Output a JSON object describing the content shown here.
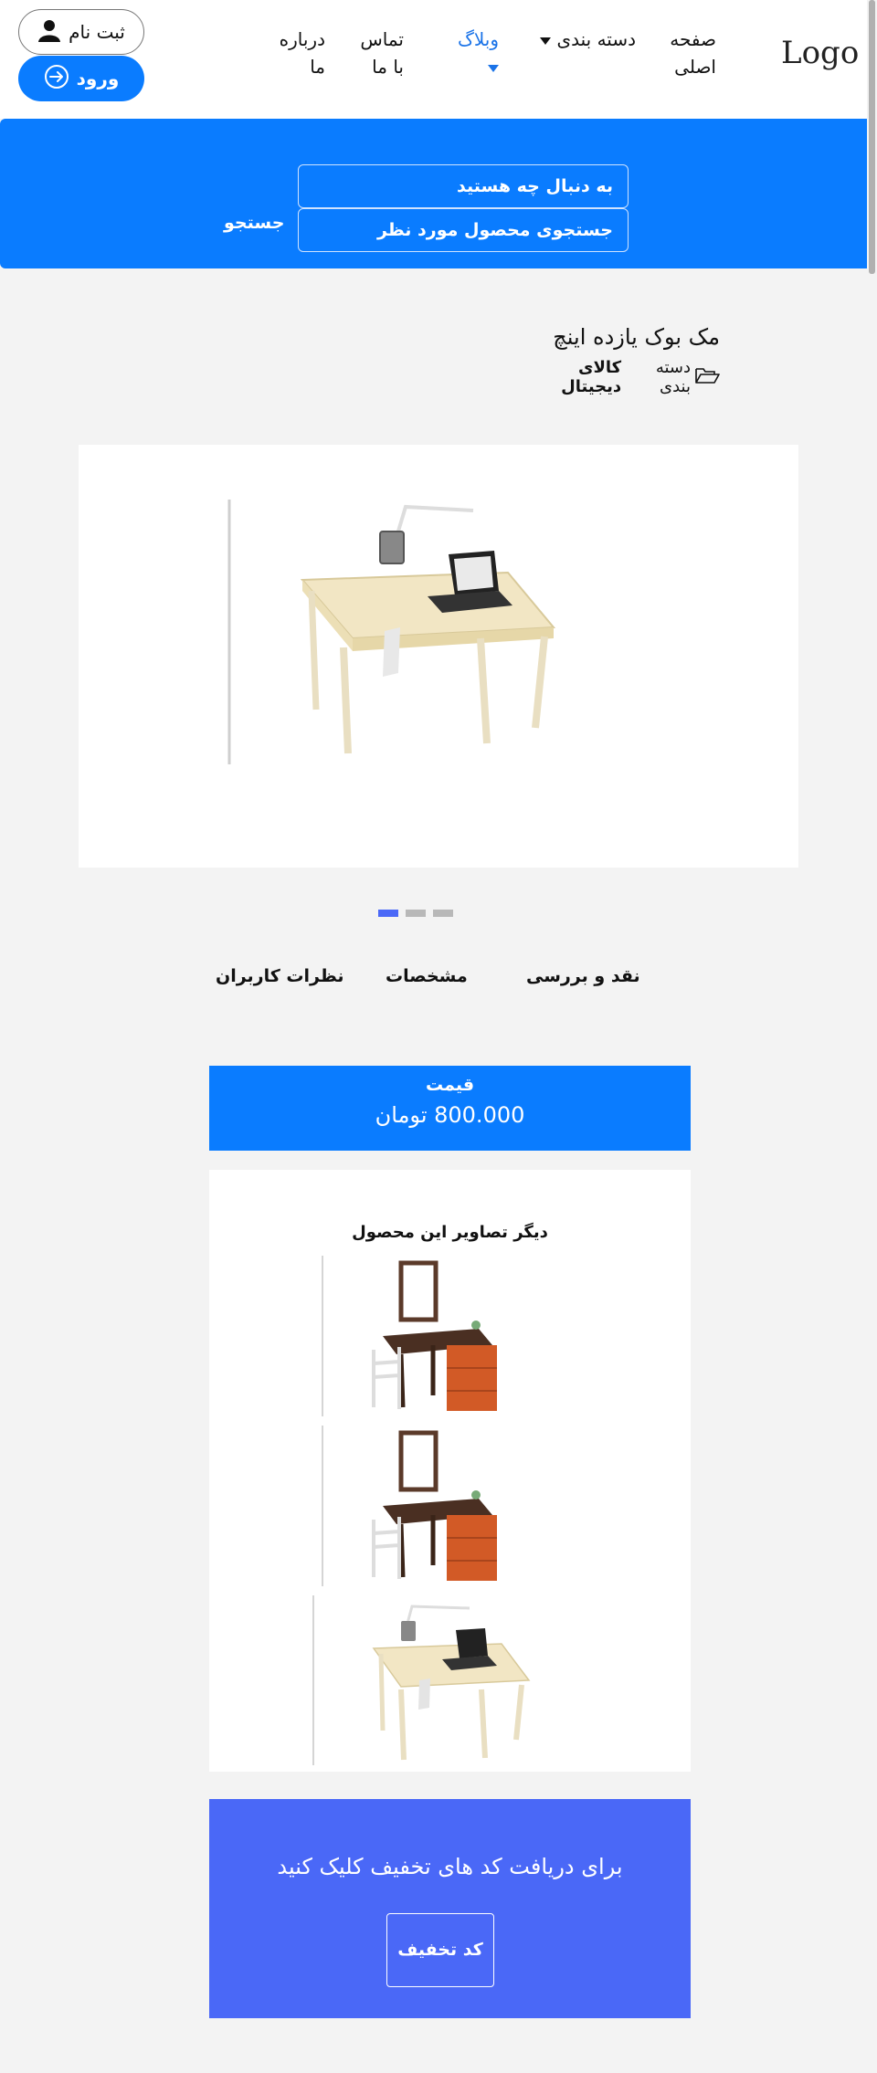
{
  "header": {
    "logo": "Logo",
    "nav": {
      "home_line1": "صفحه",
      "home_line2": "اصلی",
      "category": "دسته بندی",
      "blog": "وبلاگ",
      "contact_line1": "تماس",
      "contact_line2": "با ما",
      "about_line1": "درباره",
      "about_line2": "ما"
    },
    "register_label": "ثبت نام",
    "login_label": "ورود",
    "icons": {
      "register": "user-icon",
      "login": "login-arrow-icon",
      "dropdown": "caret-down-icon"
    }
  },
  "search": {
    "field1_placeholder": "به دنبال چه هستید",
    "field2_placeholder": "جستجوی محصول مورد نظر",
    "button_label": "جستجو"
  },
  "product": {
    "title": "مک بوک یازده اینچ",
    "category_prefix": "دسته بندی",
    "category_value": "کالای دیجیتال",
    "category_icon": "folder-open-icon"
  },
  "carousel": {
    "slides": 3,
    "active_index": 0
  },
  "tabs": {
    "review": "نقد و بررسی",
    "specs": "مشخصات",
    "comments": "نظرات کاربران"
  },
  "price": {
    "label": "قیمت",
    "value": "800.000 تومان"
  },
  "gallery": {
    "title": "دیگر تصاویر این محصول"
  },
  "promo": {
    "text": "برای دریافت کد های تخفیف کلیک کنید",
    "button_label": "کد تخفیف"
  },
  "colors": {
    "primary": "#0a7cff",
    "promo": "#4a68f7",
    "page_bg": "#f3f3f3",
    "dot_active": "#4a68f7",
    "dot_inactive": "#b8b8b8"
  }
}
